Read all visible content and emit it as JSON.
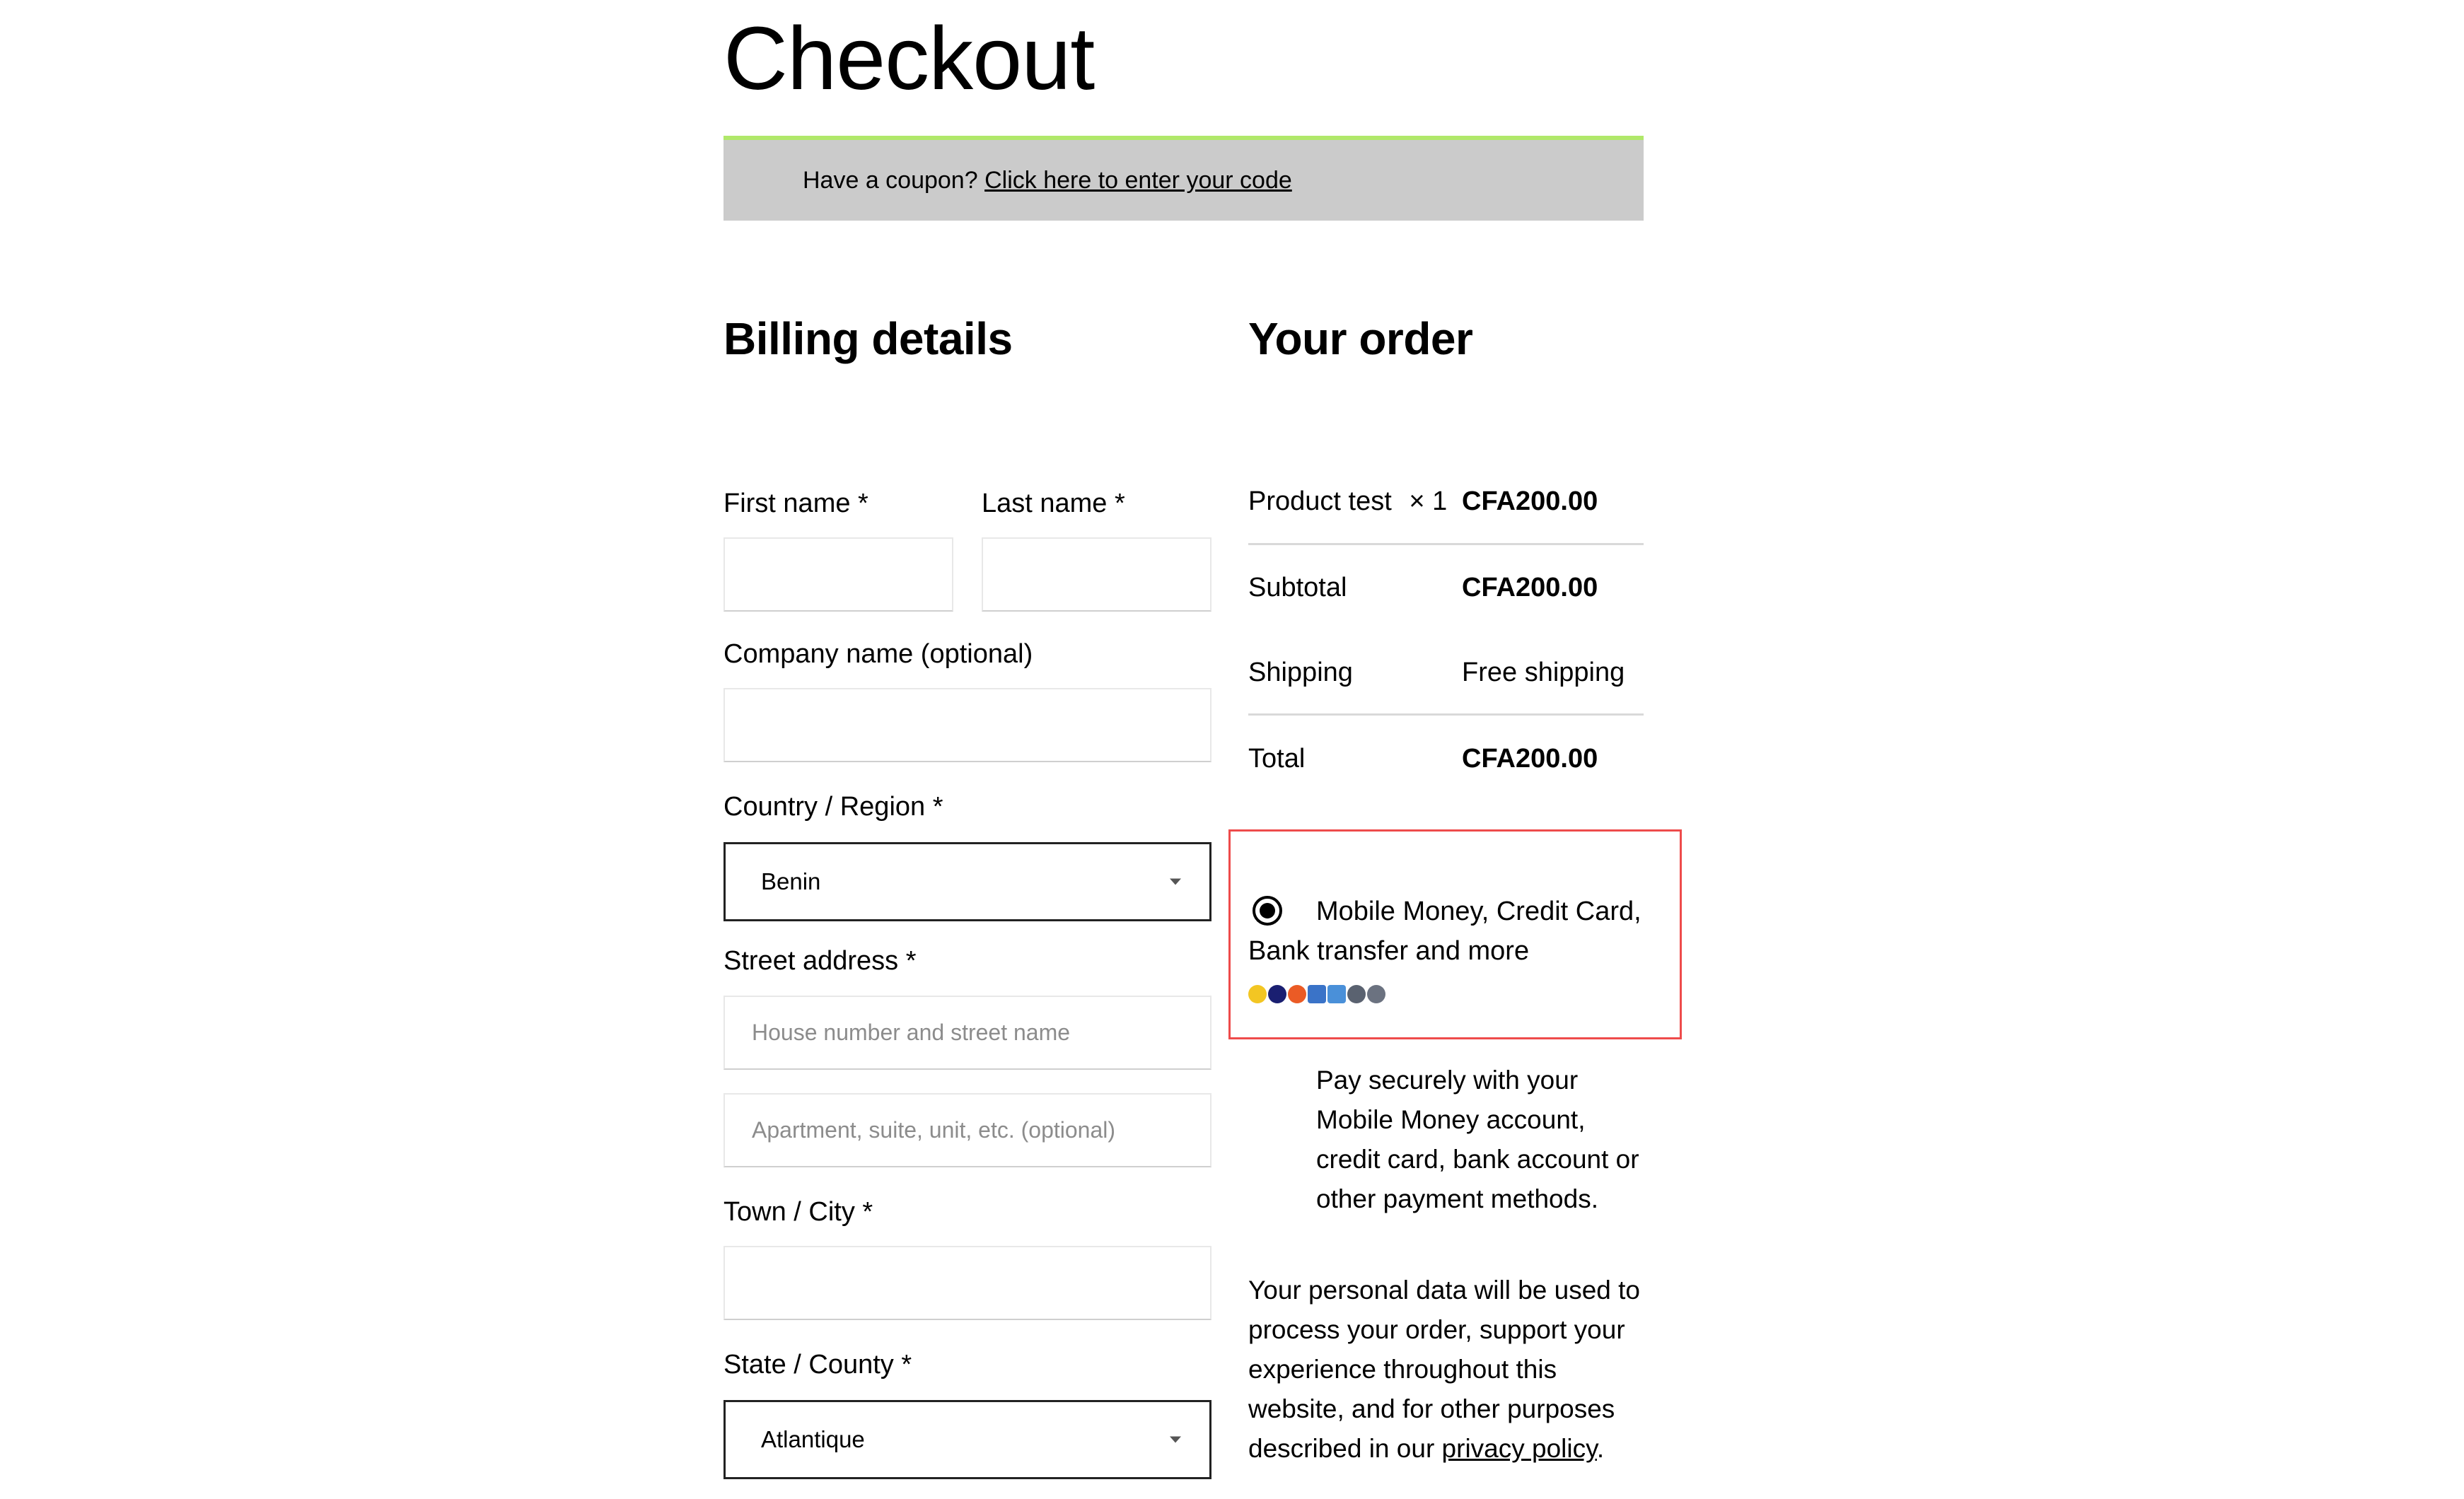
{
  "page": {
    "title": "Checkout"
  },
  "coupon": {
    "text": "Have a coupon?",
    "link": "Click here to enter your code"
  },
  "billing": {
    "heading": "Billing details",
    "first_name_label": "First name *",
    "last_name_label": "Last name *",
    "company_label": "Company name (optional)",
    "country_label": "Country / Region *",
    "country_value": "Benin",
    "street_label": "Street address *",
    "street_placeholder": "House number and street name",
    "apartment_placeholder": "Apartment, suite, unit, etc. (optional)",
    "city_label": "Town / City *",
    "state_label": "State / County *",
    "state_value": "Atlantique"
  },
  "order": {
    "heading": "Your order",
    "product_name": "Product test",
    "product_qty": "× 1",
    "product_price": "CFA200.00",
    "subtotal_label": "Subtotal",
    "subtotal_value": "CFA200.00",
    "shipping_label": "Shipping",
    "shipping_value": "Free shipping",
    "total_label": "Total",
    "total_value": "CFA200.00"
  },
  "payment": {
    "method_line1": "Mobile Money, Credit Card,",
    "method_line2": "Bank transfer and more",
    "icons": [
      "mobile-money-icon",
      "visa-icon",
      "mastercard-icon",
      "card-icon",
      "bank-icon",
      "wallet-icon",
      "transfer-icon"
    ],
    "icon_colors": [
      "#f3c623",
      "#1a1f71",
      "#eb5b25",
      "#3a73c8",
      "#4a90d9",
      "#5a6270",
      "#6b7280"
    ],
    "description_lines": [
      "Pay securely with your",
      "Mobile Money account,",
      "credit card, bank account or",
      "other payment methods."
    ]
  },
  "privacy": {
    "lines": [
      "Your personal data will be used to",
      "process your order, support your",
      "experience throughout this",
      "website, and for other purposes"
    ],
    "last_prefix": "described in our ",
    "link": "privacy policy",
    "suffix": "."
  }
}
